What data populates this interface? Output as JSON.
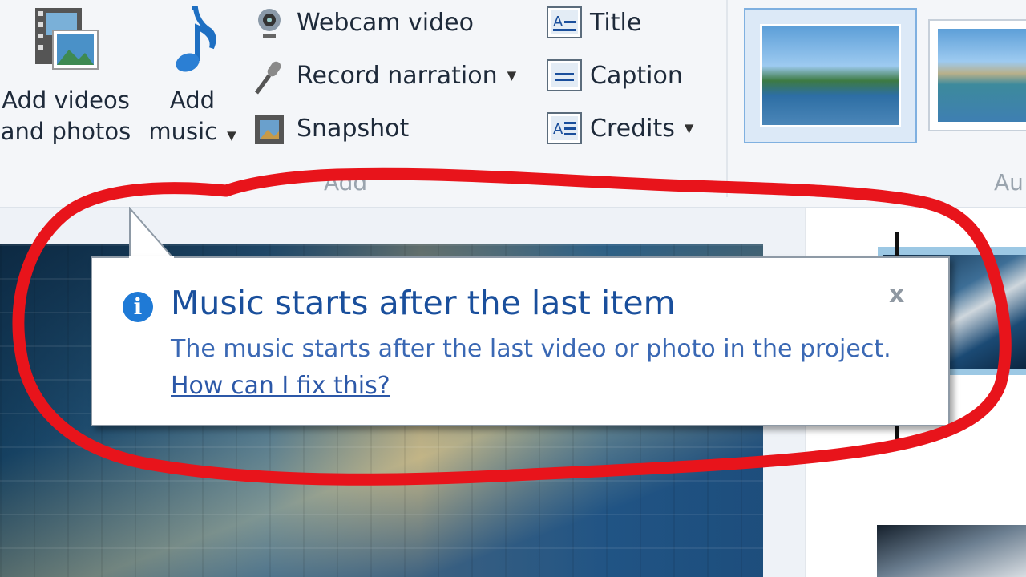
{
  "ribbon": {
    "add_videos_label_line1": "Add videos",
    "add_videos_label_line2": "and photos",
    "add_music_label_line1": "Add",
    "add_music_label_line2": "music",
    "webcam_label": "Webcam video",
    "narration_label": "Record narration",
    "snapshot_label": "Snapshot",
    "title_label": "Title",
    "caption_label": "Caption",
    "credits_label": "Credits",
    "add_group_label": "Add",
    "automovie_group_label": "Au"
  },
  "tooltip": {
    "info_glyph": "i",
    "title": "Music starts after the last item",
    "body": "The music starts after the last video or photo in the project.",
    "link": "How can I fix this?",
    "close_glyph": "x"
  },
  "colors": {
    "annotation": "#e8141b",
    "tooltip_title": "#1a4f9c",
    "info_icon": "#1f7ad6"
  }
}
